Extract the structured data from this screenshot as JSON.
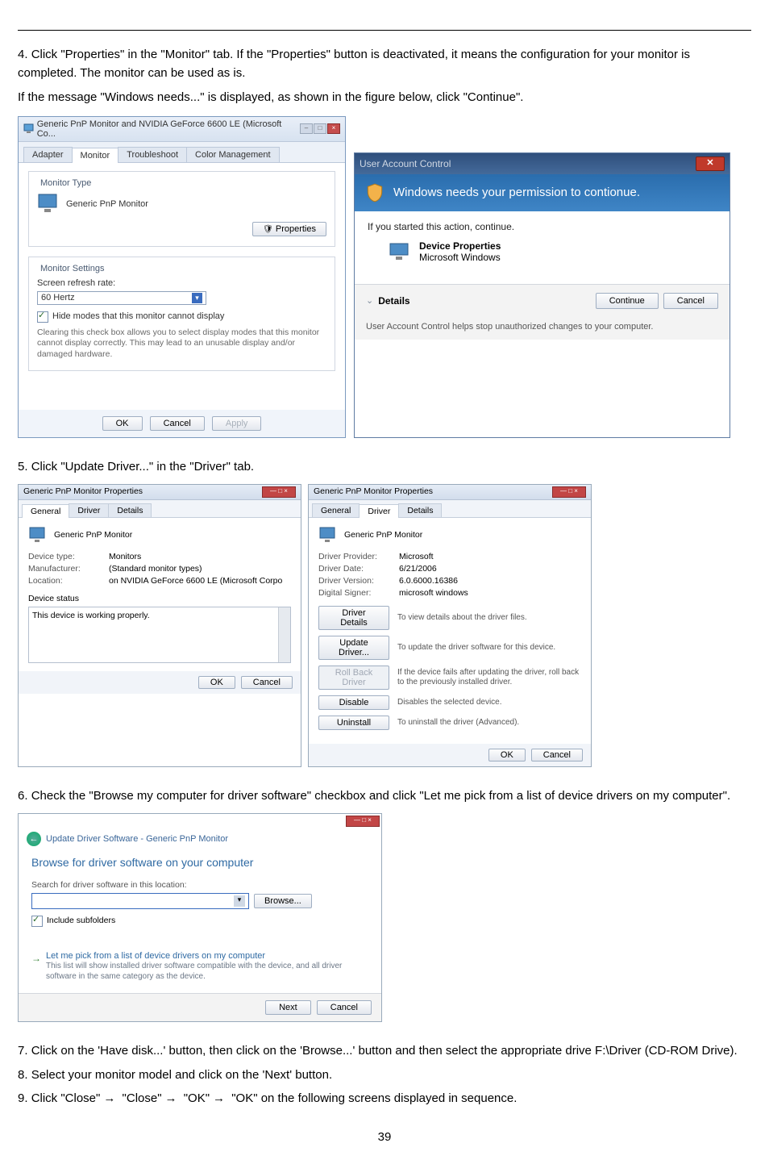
{
  "page_number": "39",
  "step4": {
    "num": "4.",
    "text_a": "Click \"Properties\" in the \"Monitor\" tab. If the \"Properties\" button is deactivated, it means the configuration for your monitor is completed. The monitor can be used as is.",
    "text_b": "If the message \"Windows needs...\" is displayed, as shown in the figure below, click \"Continue\"."
  },
  "propsDlg": {
    "title": "Generic PnP Monitor and NVIDIA GeForce 6600 LE (Microsoft Co...",
    "tabs": [
      "Adapter",
      "Monitor",
      "Troubleshoot",
      "Color Management"
    ],
    "monitorType": "Monitor Type",
    "monitorName": "Generic PnP Monitor",
    "propertiesBtn": "Properties",
    "settings": "Monitor Settings",
    "refreshLabel": "Screen refresh rate:",
    "refreshValue": "60 Hertz",
    "hideModes": "Hide modes that this monitor cannot display",
    "note": "Clearing this check box allows you to select display modes that this monitor cannot display correctly. This may lead to an unusable display and/or damaged hardware.",
    "ok": "OK",
    "cancel": "Cancel",
    "apply": "Apply"
  },
  "uac": {
    "title": "User Account Control",
    "band": "Windows needs your permission to contionue.",
    "started": "If you started this action, continue.",
    "devTitle": "Device Properties",
    "devSub": "Microsoft Windows",
    "details": "Details",
    "continue": "Continue",
    "cancel": "Cancel",
    "footnote": "User Account Control helps stop unauthorized changes to your computer."
  },
  "step5": {
    "num": "5.",
    "text": "Click \"Update Driver...\" in the \"Driver\" tab."
  },
  "genDlg": {
    "title": "Generic PnP Monitor Properties",
    "tabs": [
      "General",
      "Driver",
      "Details"
    ],
    "name": "Generic PnP Monitor",
    "lines": [
      {
        "k": "Device type:",
        "v": "Monitors"
      },
      {
        "k": "Manufacturer:",
        "v": "(Standard monitor types)"
      },
      {
        "k": "Location:",
        "v": "on NVIDIA GeForce 6600 LE (Microsoft Corpo"
      }
    ],
    "statusLabel": "Device status",
    "statusText": "This device is working properly.",
    "ok": "OK",
    "cancel": "Cancel"
  },
  "drvDlg": {
    "title": "Generic PnP Monitor Properties",
    "tabs": [
      "General",
      "Driver",
      "Details"
    ],
    "name": "Generic PnP Monitor",
    "lines": [
      {
        "k": "Driver Provider:",
        "v": "Microsoft"
      },
      {
        "k": "Driver Date:",
        "v": "6/21/2006"
      },
      {
        "k": "Driver Version:",
        "v": "6.0.6000.16386"
      },
      {
        "k": "Digital Signer:",
        "v": "microsoft windows"
      }
    ],
    "btns": [
      {
        "label": "Driver Details",
        "desc": "To view details about the driver files.",
        "dis": false
      },
      {
        "label": "Update Driver...",
        "desc": "To update the driver software for this device.",
        "dis": false
      },
      {
        "label": "Roll Back Driver",
        "desc": "If the device fails after updating the driver, roll back to the previously installed driver.",
        "dis": true
      },
      {
        "label": "Disable",
        "desc": "Disables the selected device.",
        "dis": false
      },
      {
        "label": "Uninstall",
        "desc": "To uninstall the driver (Advanced).",
        "dis": false
      }
    ],
    "ok": "OK",
    "cancel": "Cancel"
  },
  "step6": {
    "num": "6.",
    "text": "Check the \"Browse my computer for driver software\" checkbox and click \"Let me pick from a list of device drivers on my computer\"."
  },
  "wiz": {
    "bc": "Update Driver Software - Generic PnP Monitor",
    "h": "Browse for driver software on your computer",
    "searchLbl": "Search for driver software in this location:",
    "loc": "",
    "browse": "Browse...",
    "include": "Include subfolders",
    "pickTitle": "Let me pick from a list of device drivers on my computer",
    "pickSub": "This list will show installed driver software compatible with the device, and all driver software in the same category as the device.",
    "next": "Next",
    "cancel": "Cancel"
  },
  "step7": {
    "num": "7.",
    "text": "Click on the 'Have disk...' button, then click on the 'Browse...' button and then select the appropriate drive F:\\Driver (CD-ROM Drive)."
  },
  "step8": {
    "num": "8.",
    "text": "Select your monitor model and click on the 'Next' button."
  },
  "step9": {
    "num": "9.",
    "a": "Click \"Close\"",
    "b": "\"Close\"",
    "c": "\"OK\"",
    "d": "\"OK\" on the following screens displayed in sequence."
  }
}
